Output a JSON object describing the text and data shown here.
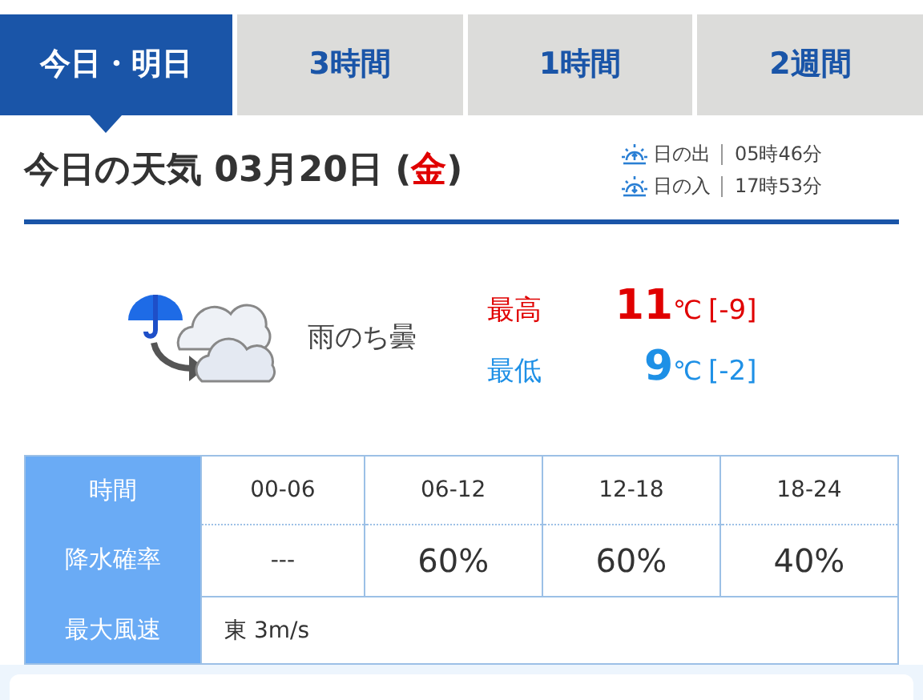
{
  "tabs": [
    {
      "label": "今日・明日",
      "selected": true
    },
    {
      "label": "3時間",
      "selected": false
    },
    {
      "label": "1時間",
      "selected": false
    },
    {
      "label": "2週間",
      "selected": false
    }
  ],
  "heading": {
    "title": "今日の天気 03月20日",
    "weekday": "(金)"
  },
  "sun": [
    {
      "kind": "rise",
      "label": "日の出",
      "time": "05時46分"
    },
    {
      "kind": "set",
      "label": "日の入",
      "time": "17時53分"
    }
  ],
  "forecast": {
    "condition": "雨のち曇",
    "temps": [
      {
        "kind": "high",
        "label": "最高",
        "value": "11",
        "unit": "℃",
        "diff": "[-9]"
      },
      {
        "kind": "low",
        "label": "最低",
        "value": "9",
        "unit": "℃",
        "diff": "[-2]"
      }
    ]
  },
  "table": {
    "rows": [
      {
        "kind": "time",
        "header": "時間",
        "cells": [
          "00-06",
          "06-12",
          "12-18",
          "18-24"
        ]
      },
      {
        "kind": "rain",
        "header": "降水確率",
        "cells": [
          "---",
          "60%",
          "60%",
          "40%"
        ]
      },
      {
        "kind": "wind",
        "header": "最大風速",
        "cells": [
          {
            "text": "東 3m/s",
            "colspan": 4
          }
        ]
      }
    ]
  }
}
